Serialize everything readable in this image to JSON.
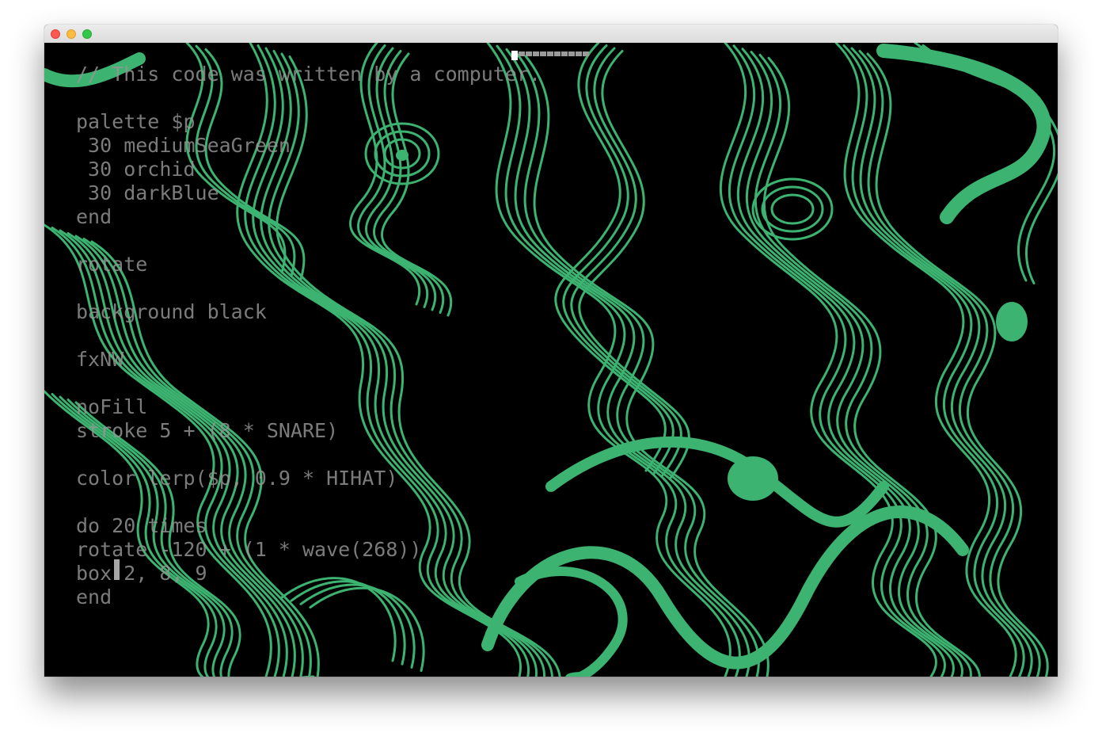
{
  "window": {
    "controls": [
      "close",
      "minimize",
      "maximize"
    ]
  },
  "editor": {
    "lines": [
      "// This code was written by a computer.",
      "",
      "palette $p",
      " 30 mediumSeaGreen",
      " 30 orchid",
      " 30 darkBlue",
      "end",
      "",
      "rotate",
      "",
      "background black",
      "",
      "fxNW",
      "",
      "noFill",
      "stroke 5 + (8 * SNARE)",
      "",
      "color lerp($p, 0.9 * HIHAT)",
      "",
      "do 20 times",
      "rotate -120 + (1 * wave(268))",
      "box 2, 8, 9",
      "end"
    ]
  },
  "visual": {
    "background_color": "#000000",
    "stroke_color": "#3cb371",
    "stroke_color_name": "mediumSeaGreen"
  },
  "perf_meter": {
    "segments": 11
  }
}
